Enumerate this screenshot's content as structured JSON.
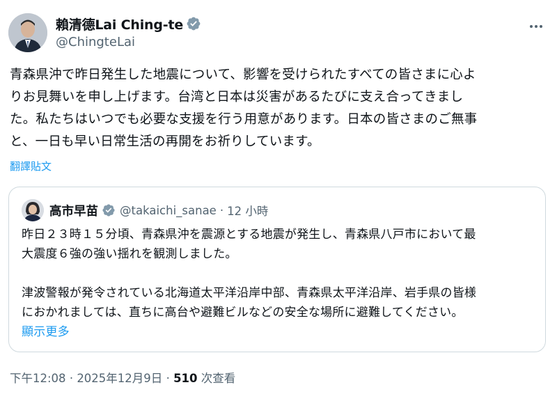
{
  "tweet": {
    "author": {
      "display_name": "賴清德Lai Ching-te",
      "handle": "@ChingteLai",
      "verified": true
    },
    "more_icon": "more-horizontal-icon",
    "body_lines": [
      "青森県沖で昨日発生した地震について、影響を受けられたすべての皆さまに心よ",
      "りお見舞いを申し上げます。台湾と日本は災害があるたびに支え合ってきまし",
      "た。私たちはいつでも必要な支援を行う用意があります。日本の皆さまのご無事",
      "と、一日も早い日常生活の再開をお祈りしています。"
    ],
    "translate_label": "翻譯貼文",
    "quoted": {
      "display_name": "高市早苗",
      "handle": "@takaichi_sanae",
      "separator": "·",
      "time": "12 小時",
      "verified": true,
      "body_lines": [
        "昨日２３時１５分頃、青森県沖を震源とする地震が発生し、青森県八戸市において最",
        "大震度６強の強い揺れを観測しました。",
        "",
        "津波警報が発令されている北海道太平洋沿岸中部、青森県太平洋沿岸、岩手県の皆様",
        "におかれましては、直ちに高台や避難ビルなどの安全な場所に避難してください。"
      ],
      "show_more_label": "顯示更多"
    },
    "meta": {
      "time": "下午12:08",
      "separator": "·",
      "date": "2025年12月9日",
      "separator2": "·",
      "views_count": "510",
      "views_label": "次查看"
    }
  },
  "colors": {
    "accent": "#1d9bf0",
    "secondary_text": "#536471",
    "border": "#cfd9de",
    "verified_badge": "#829aab"
  }
}
